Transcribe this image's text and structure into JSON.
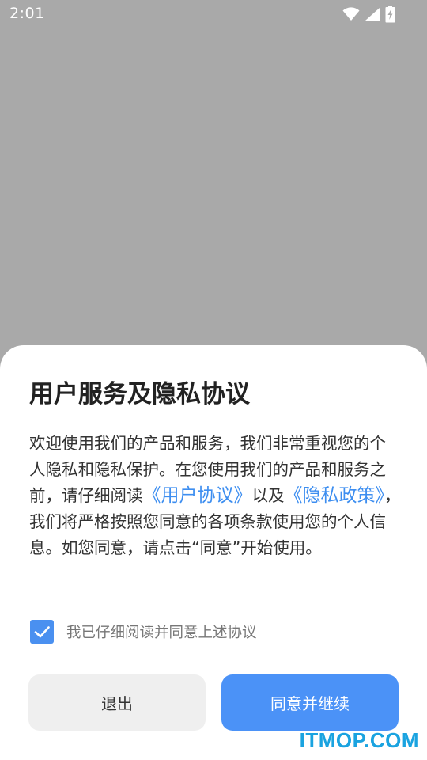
{
  "status_bar": {
    "time": "2:01",
    "icons": [
      "wifi-icon",
      "signal-icon",
      "battery-charging-icon"
    ]
  },
  "dialog": {
    "title": "用户服务及隐私协议",
    "body": {
      "part1": "欢迎使用我们的产品和服务，我们非常重视您的个人隐私和隐私保护。在您使用我们的产品和服务之前，请仔细阅读",
      "link_user_agreement": "《用户协议》",
      "part2": "以及",
      "link_privacy_policy": "《隐私政策》",
      "part3": "，我们将严格按照您同意的各项条款使用您的个人信息。如您同意，请点击“同意”开始使用。"
    },
    "agree_checkbox": {
      "checked": true,
      "label": "我已仔细阅读并同意上述协议"
    },
    "buttons": {
      "exit": "退出",
      "agree": "同意并继续"
    }
  },
  "watermark": "ITMOP.COM",
  "colors": {
    "overlay": "#a9a9a9",
    "link": "#3d8ef0",
    "primary": "#4b92f7",
    "secondary_button": "#efefef",
    "watermark": "#1aa3e0"
  }
}
